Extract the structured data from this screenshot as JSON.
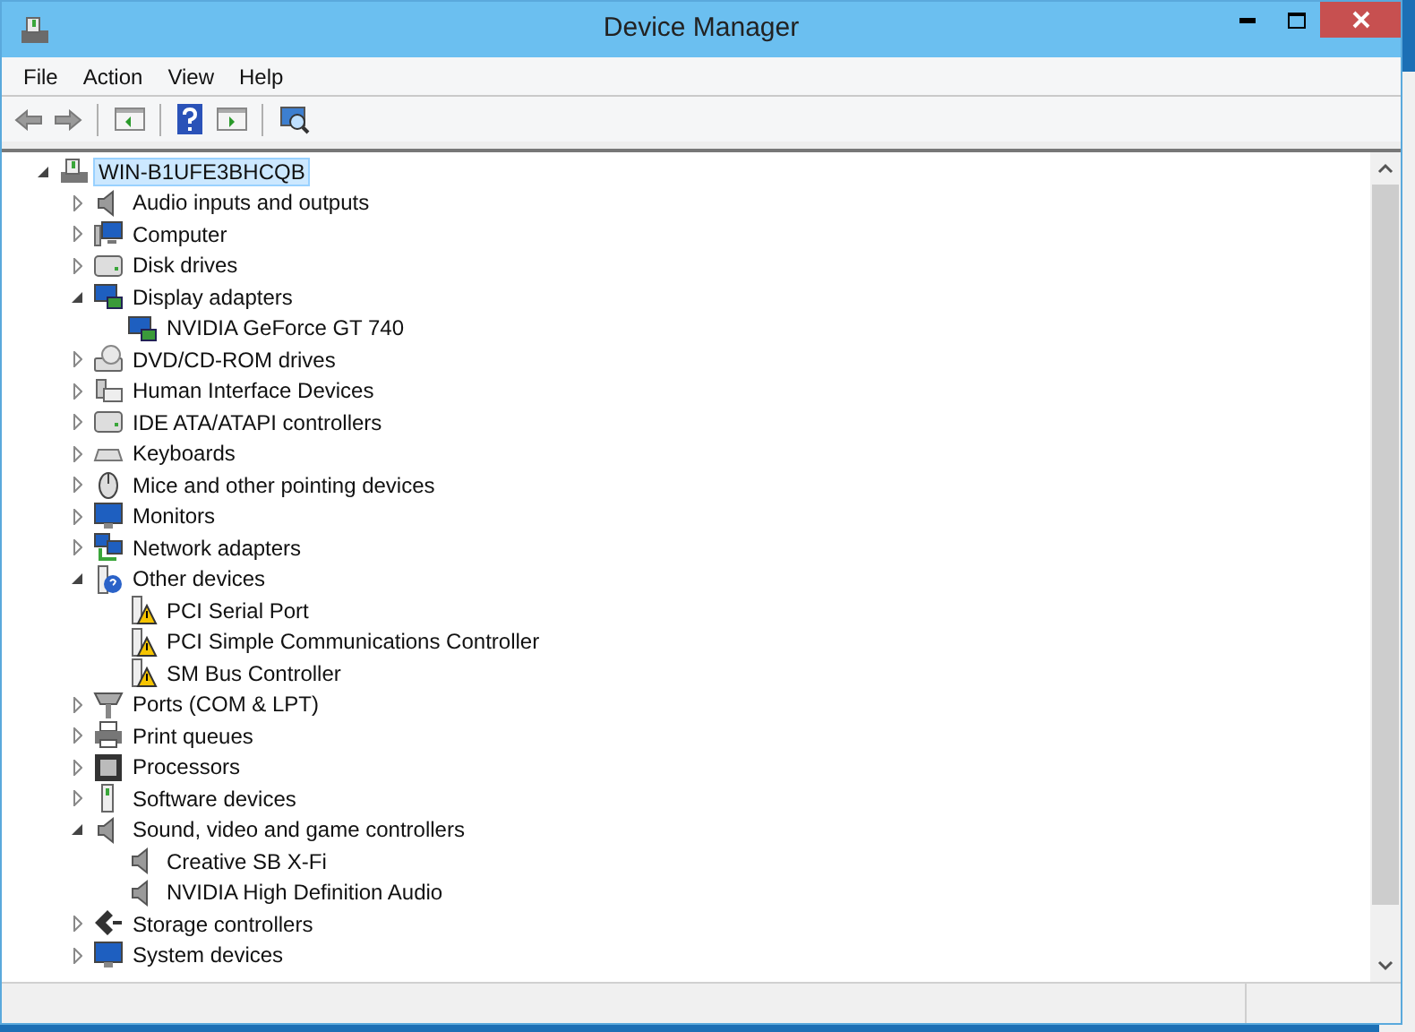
{
  "window": {
    "title": "Device Manager"
  },
  "menu": [
    "File",
    "Action",
    "View",
    "Help"
  ],
  "tree": {
    "label": "WIN-B1UFE3BHCQB",
    "kind": "computer",
    "expanded": true,
    "selected": true,
    "children": [
      {
        "label": "Audio inputs and outputs",
        "kind": "speaker",
        "expanded": false,
        "selected": false
      },
      {
        "label": "Computer",
        "kind": "pc",
        "expanded": false,
        "selected": false
      },
      {
        "label": "Disk drives",
        "kind": "disk",
        "expanded": false,
        "selected": false
      },
      {
        "label": "Display adapters",
        "kind": "display",
        "expanded": true,
        "selected": false,
        "children": [
          {
            "label": "NVIDIA GeForce GT 740",
            "kind": "display",
            "selected": false
          }
        ]
      },
      {
        "label": "DVD/CD-ROM drives",
        "kind": "dvd",
        "expanded": false,
        "selected": false
      },
      {
        "label": "Human Interface Devices",
        "kind": "hid",
        "expanded": false,
        "selected": false
      },
      {
        "label": "IDE ATA/ATAPI controllers",
        "kind": "disk",
        "expanded": false,
        "selected": false
      },
      {
        "label": "Keyboards",
        "kind": "keyboard",
        "expanded": false,
        "selected": false
      },
      {
        "label": "Mice and other pointing devices",
        "kind": "mouse",
        "expanded": false,
        "selected": false
      },
      {
        "label": "Monitors",
        "kind": "monitor",
        "expanded": false,
        "selected": false
      },
      {
        "label": "Network adapters",
        "kind": "network",
        "expanded": false,
        "selected": false
      },
      {
        "label": "Other devices",
        "kind": "unknown",
        "expanded": true,
        "selected": false,
        "children": [
          {
            "label": "PCI Serial Port",
            "kind": "warning",
            "selected": false
          },
          {
            "label": "PCI Simple Communications Controller",
            "kind": "warning",
            "selected": false
          },
          {
            "label": "SM Bus Controller",
            "kind": "warning",
            "selected": false
          }
        ]
      },
      {
        "label": "Ports (COM & LPT)",
        "kind": "port",
        "expanded": false,
        "selected": false
      },
      {
        "label": "Print queues",
        "kind": "printer",
        "expanded": false,
        "selected": false
      },
      {
        "label": "Processors",
        "kind": "processor",
        "expanded": false,
        "selected": false
      },
      {
        "label": "Software devices",
        "kind": "software",
        "expanded": false,
        "selected": false
      },
      {
        "label": "Sound, video and game controllers",
        "kind": "speaker",
        "expanded": true,
        "selected": false,
        "children": [
          {
            "label": "Creative SB X-Fi",
            "kind": "speaker",
            "selected": false
          },
          {
            "label": "NVIDIA High Definition Audio",
            "kind": "speaker",
            "selected": false
          }
        ]
      },
      {
        "label": "Storage controllers",
        "kind": "storage",
        "expanded": false,
        "selected": false
      },
      {
        "label": "System devices",
        "kind": "monitor",
        "expanded": false,
        "selected": false
      }
    ]
  }
}
